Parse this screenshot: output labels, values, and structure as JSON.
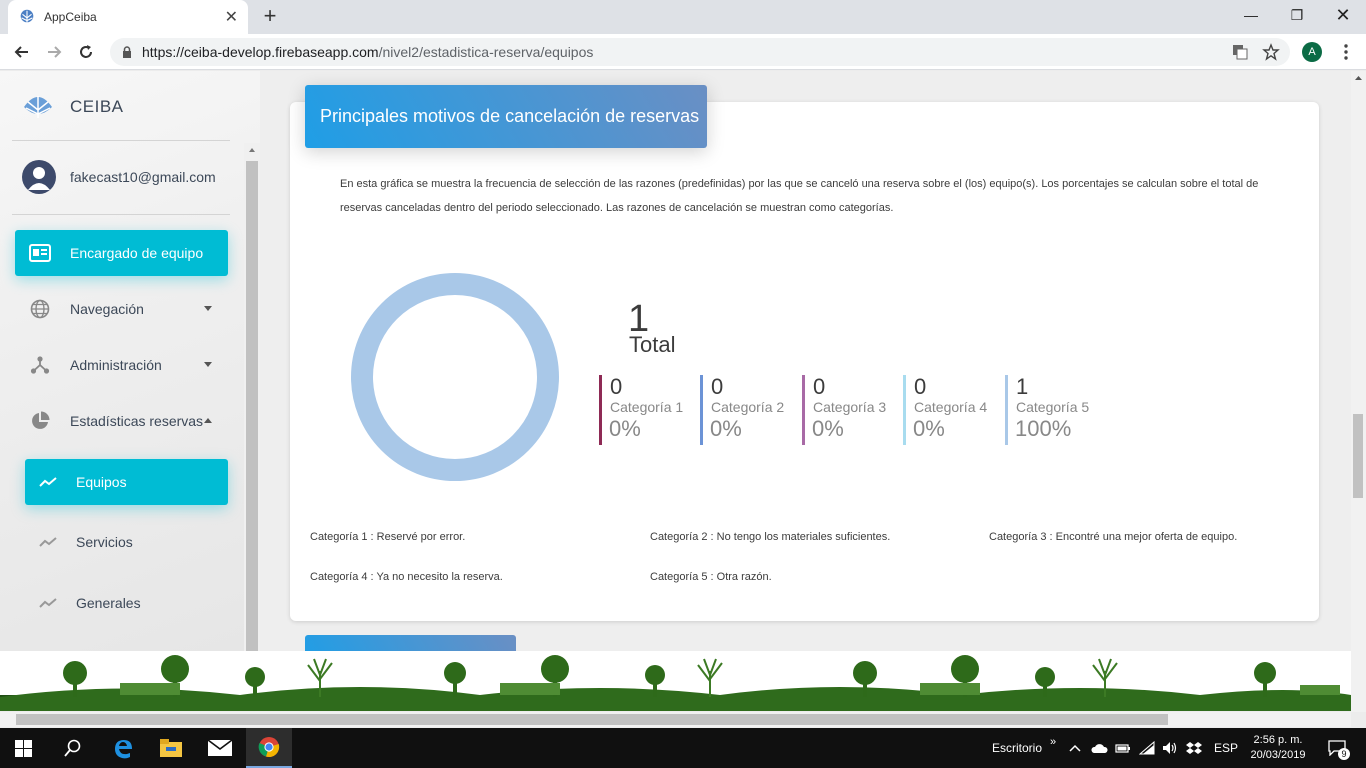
{
  "browser": {
    "tab_title": "AppCeiba",
    "url_host": "https://ceiba-develop.firebaseapp.com",
    "url_path": "/nivel2/estadistica-reserva/equipos",
    "profile_initial": "A"
  },
  "sidebar": {
    "brand": "CEIBA",
    "user_email": "fakecast10@gmail.com",
    "items": [
      {
        "label": "Encargado de equipo",
        "icon": "id-card-icon"
      },
      {
        "label": "Navegación",
        "icon": "globe-icon"
      },
      {
        "label": "Administración",
        "icon": "network-icon"
      },
      {
        "label": "Estadísticas reservas",
        "icon": "pie-chart-icon"
      }
    ],
    "subitems": [
      {
        "label": "Equipos",
        "icon": "trending-icon"
      },
      {
        "label": "Servicios",
        "icon": "trending-icon"
      },
      {
        "label": "Generales",
        "icon": "trending-icon"
      }
    ]
  },
  "card": {
    "title": "Principales motivos de cancelación de reservas",
    "description": "En esta gráfica se muestra la frecuencia de selección de las razones (predefinidas) por las que se canceló una reserva sobre el (los) equipo(s). Los porcentajes se calculan sobre el total de reservas canceladas dentro del periodo seleccionado. Las razones de cancelación se muestran como categorías.",
    "total_value": "1",
    "total_label": "Total",
    "categories": [
      {
        "value": "0",
        "name": "Categoría 1",
        "percent": "0%",
        "color": "#8e2a55"
      },
      {
        "value": "0",
        "name": "Categoría 2",
        "percent": "0%",
        "color": "#6c93d6"
      },
      {
        "value": "0",
        "name": "Categoría 3",
        "percent": "0%",
        "color": "#a86aa6"
      },
      {
        "value": "0",
        "name": "Categoría 4",
        "percent": "0%",
        "color": "#a8dcef"
      },
      {
        "value": "1",
        "name": "Categoría 5",
        "percent": "100%",
        "color": "#a9c8e8"
      }
    ],
    "legend": [
      "Categoría 1 : Reservé por error.",
      "Categoría 2 : No tengo los materiales suficientes.",
      "Categoría 3 : Encontré una mejor oferta de equipo.",
      "Categoría 4 : Ya no necesito la reserva.",
      "Categoría 5 : Otra razón."
    ]
  },
  "chart_data": {
    "type": "pie",
    "categories": [
      "Categoría 1",
      "Categoría 2",
      "Categoría 3",
      "Categoría 4",
      "Categoría 5"
    ],
    "values": [
      0,
      0,
      0,
      0,
      1
    ],
    "colors": [
      "#8e2a55",
      "#6c93d6",
      "#a86aa6",
      "#a8dcef",
      "#a9c8e8"
    ],
    "title": "Principales motivos de cancelación de reservas"
  },
  "taskbar": {
    "desktop_label": "Escritorio",
    "language": "ESP",
    "time": "2:56 p. m.",
    "date": "20/03/2019",
    "notifications": "9"
  }
}
